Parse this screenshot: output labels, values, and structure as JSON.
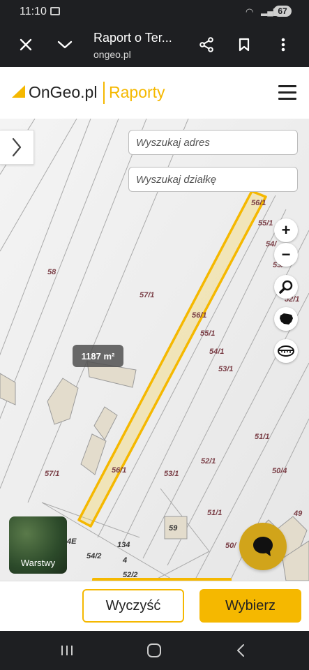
{
  "status_bar": {
    "time": "11:10",
    "battery": "67"
  },
  "browser": {
    "page_title": "Raport o Ter...",
    "url": "ongeo.pl",
    "icons": [
      "close-icon",
      "chevron-down-icon",
      "share-icon",
      "bookmark-icon",
      "more-vert-icon"
    ]
  },
  "site": {
    "logo_text": "OnGeo.pl",
    "section": "Raporty"
  },
  "search": {
    "address_placeholder": "Wyszukaj adres",
    "parcel_placeholder": "Wyszukaj działkę"
  },
  "map": {
    "area_label": "1187 m²",
    "parcel_labels": [
      "56/1",
      "55/1",
      "54/",
      "53/",
      "52/1",
      "58",
      "57/1",
      "56/1",
      "55/1",
      "54/1",
      "53/1",
      "51/1",
      "57/1",
      "56/1",
      "53/1",
      "52/1",
      "50/4",
      "51/1",
      "49",
      "59",
      "134",
      "4E",
      "54/2",
      "4",
      "52/2",
      "50/"
    ],
    "controls": [
      "zoom-in-icon",
      "zoom-out-icon",
      "magnifier-icon",
      "poland-map-icon",
      "tape-measure-icon"
    ],
    "zoom_in": "+",
    "zoom_out": "−",
    "layers_label": "Warstwy"
  },
  "actions": {
    "clear": "Wyczyść",
    "select": "Wybierz"
  },
  "colors": {
    "accent": "#f5b800",
    "chat": "#d1a41a",
    "bars": "#1e1f22"
  }
}
